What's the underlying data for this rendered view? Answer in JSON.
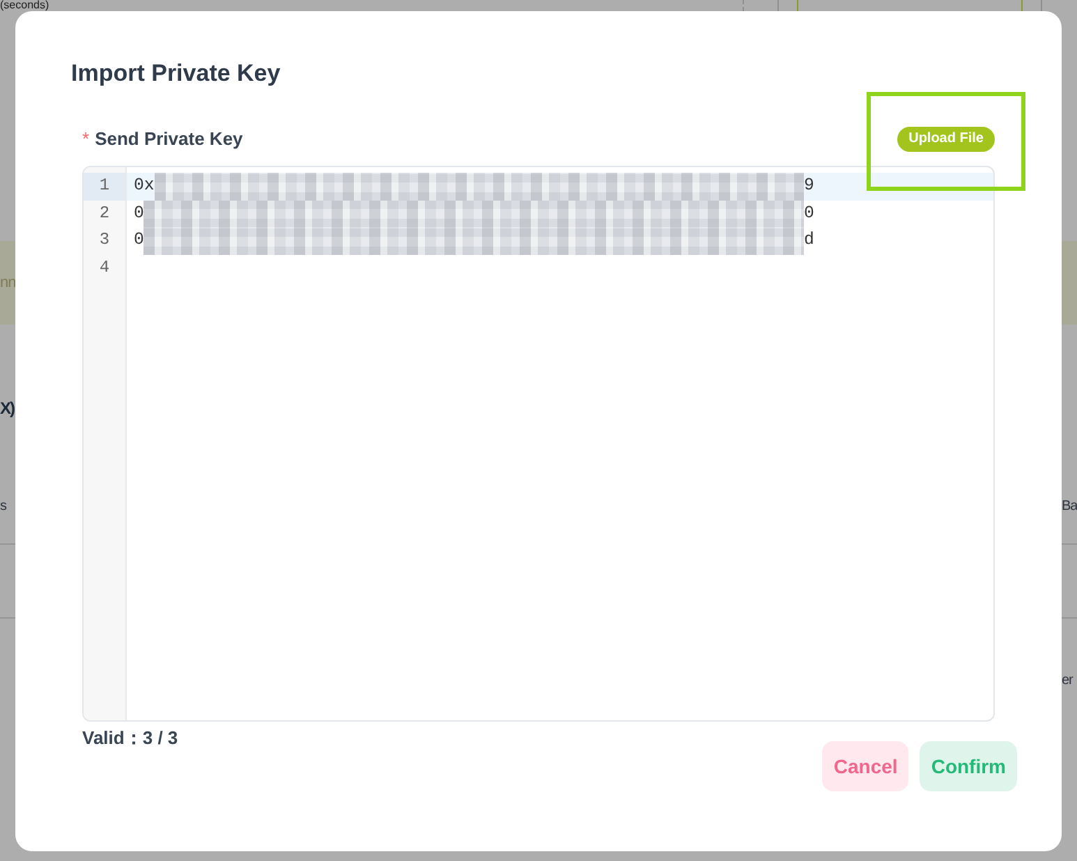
{
  "background_page": {
    "rows": [
      {
        "kind": "title",
        "left": "(seconds)"
      },
      {
        "kind": "banner",
        "left": "nn"
      },
      {
        "kind": "heading",
        "left": "X)"
      },
      {
        "kind": "table_header",
        "left": "s",
        "right": "Ba"
      },
      {
        "kind": "table_row"
      },
      {
        "kind": "table_row",
        "right": "er"
      }
    ]
  },
  "dialog": {
    "title": "Import Private Key",
    "field": {
      "required_mark": "*",
      "label": "Send Private Key",
      "upload_button": {
        "label": "Upload File",
        "highlighted": true
      },
      "editor": {
        "lines": [
          {
            "number": "1",
            "start": "0x",
            "end": "9",
            "redacted": true,
            "active": true
          },
          {
            "number": "2",
            "start": "0",
            "end": "0",
            "redacted": true,
            "active": false
          },
          {
            "number": "3",
            "start": "0",
            "end": "d",
            "redacted": true,
            "active": false
          },
          {
            "number": "4",
            "redacted": false,
            "active": false
          }
        ]
      },
      "validation": "Valid：3 / 3"
    },
    "buttons": [
      {
        "label": "Cancel",
        "kind": "cancel"
      },
      {
        "label": "Confirm",
        "kind": "confirm"
      }
    ]
  }
}
